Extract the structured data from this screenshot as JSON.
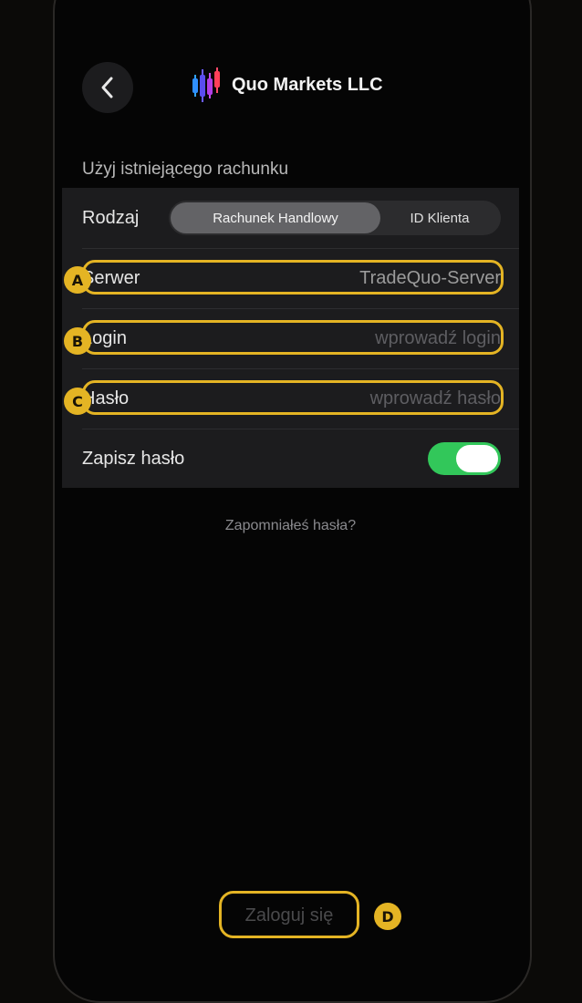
{
  "header": {
    "back_icon": "chevron-left-icon",
    "brand_logo": "candlestick-logo",
    "title": "Quo Markets LLC"
  },
  "section_title": "Użyj istniejącego rachunku",
  "form": {
    "type_label": "Rodzaj",
    "type_options": [
      "Rachunek Handlowy",
      "ID Klienta"
    ],
    "type_selected": "Rachunek Handlowy",
    "server_label": "Serwer",
    "server_value": "TradeQuo-Server",
    "login_label": "Login",
    "login_placeholder": "wprowadź login",
    "password_label": "Hasło",
    "password_placeholder": "wprowadź hasło",
    "save_password_label": "Zapisz hasło",
    "save_password_on": true
  },
  "forgot_password": "Zapomniałeś hasła?",
  "login_button": "Zaloguj się",
  "annotations": [
    "A",
    "B",
    "C",
    "D"
  ],
  "colors": {
    "background": "#050505",
    "panel": "#1c1c1e",
    "highlight": "#e4b424",
    "toggle_on": "#32c75a"
  }
}
